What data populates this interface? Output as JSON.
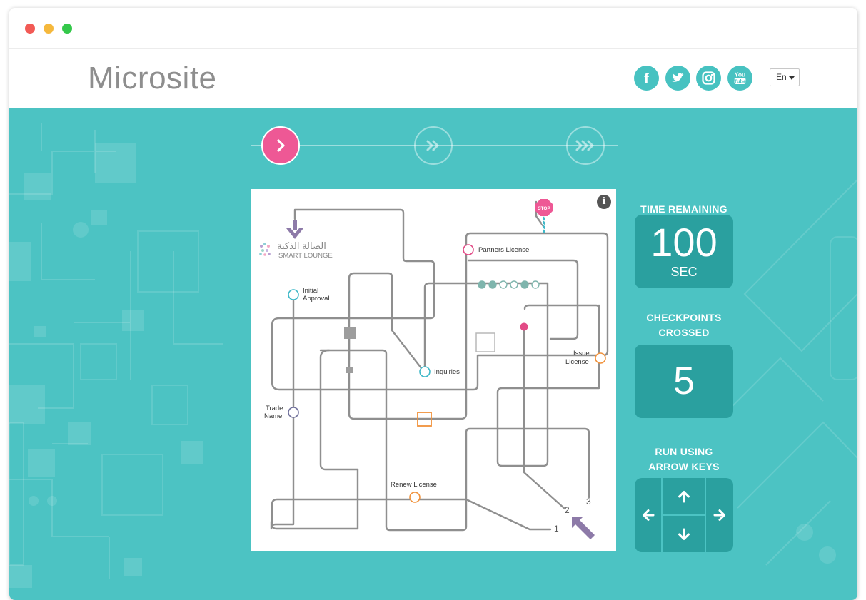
{
  "window": {
    "controls": [
      "close",
      "minimize",
      "maximize"
    ]
  },
  "header": {
    "logo": "Microsite",
    "social": [
      {
        "name": "facebook-icon",
        "glyph": "f"
      },
      {
        "name": "twitter-icon",
        "glyph": "twitter"
      },
      {
        "name": "instagram-icon",
        "glyph": "instagram"
      },
      {
        "name": "youtube-icon",
        "glyph": "You Tube"
      }
    ],
    "language": {
      "selected": "En"
    },
    "youtube_top": "You",
    "youtube_bottom": "Tube"
  },
  "steps": [
    {
      "label": "step-1",
      "icon": "chevron-right-icon",
      "active": true
    },
    {
      "label": "step-2",
      "icon": "double-chevron-right-icon",
      "active": false
    },
    {
      "label": "step-3",
      "icon": "triple-chevron-right-icon",
      "active": false
    }
  ],
  "maze": {
    "brand_arabic": "الصالة الذكية",
    "brand_english": "SMART LOUNGE",
    "stop_sign": "STOP",
    "checkpoints": {
      "partners_license": "Partners License",
      "initial_approval_1": "Initial",
      "initial_approval_2": "Approval",
      "inquiries": "Inquiries",
      "issue_license_1": "Issue",
      "issue_license_2": "License",
      "trade_name_1": "Trade",
      "trade_name_2": "Name",
      "renew_license": "Renew License"
    },
    "start_numbers": [
      "1",
      "2",
      "3"
    ],
    "info": "i"
  },
  "stats": {
    "time_title": "TIME REMAINING",
    "time_value": "100",
    "time_unit": "SEC",
    "checkpoints_title_1": "CHECKPOINTS",
    "checkpoints_title_2": "CROSSED",
    "checkpoints_value": "5",
    "controls_title_1": "RUN USING",
    "controls_title_2": "ARROW  KEYS"
  },
  "colors": {
    "teal_bg": "#4cc3c3",
    "teal_dark": "#2aa09f",
    "accent_pink": "#ee5895",
    "path_gray": "#8f8f8f",
    "arrow_purple": "#8d7aa8",
    "checkpoint_orange": "#f0913a",
    "checkpoint_blue": "#3fb8c8"
  }
}
